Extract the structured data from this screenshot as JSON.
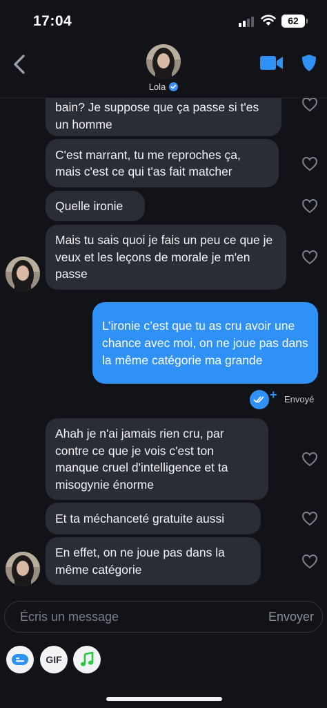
{
  "status_bar": {
    "time": "17:04",
    "battery": "62"
  },
  "header": {
    "contact_name": "Lola",
    "verified": true
  },
  "messages": [
    {
      "direction": "in",
      "text": "bain? Je suppose que ça passe si t'es un homme"
    },
    {
      "direction": "in",
      "text": "C'est marrant, tu me reproches ça, mais c'est ce qui t'as fait matcher"
    },
    {
      "direction": "in",
      "text": "Quelle ironie"
    },
    {
      "direction": "in",
      "text": "Mais tu sais quoi je fais un peu ce que je veux et les leçons de morale je m'en passe"
    },
    {
      "direction": "out",
      "text": "L’ironie c’est que tu as cru avoir une chance avec moi, on ne joue pas dans la même catégorie ma grande"
    },
    {
      "direction": "in",
      "text": "Ahah je n'ai jamais rien cru, par contre ce que je vois c'est ton manque cruel d'intelligence et ta misogynie énorme"
    },
    {
      "direction": "in",
      "text": "Et ta méchanceté gratuite aussi"
    },
    {
      "direction": "in",
      "text": "En effet, on ne joue pas dans la même catégorie"
    }
  ],
  "delivery_status": "Envoyé",
  "composer": {
    "placeholder": "Écris un message",
    "send_label": "Envoyer"
  },
  "toolbar": {
    "gif_label": "GIF"
  },
  "icons": [
    "back-chevron-icon",
    "video-call-icon",
    "shield-icon",
    "heart-icon",
    "read-check-icon",
    "sticker-icon",
    "music-note-icon"
  ],
  "colors": {
    "background": "#111318",
    "incoming_bubble": "#2a2d35",
    "outgoing_bubble": "#2f91f5",
    "accent": "#2f91f5",
    "music": "#28c840"
  }
}
